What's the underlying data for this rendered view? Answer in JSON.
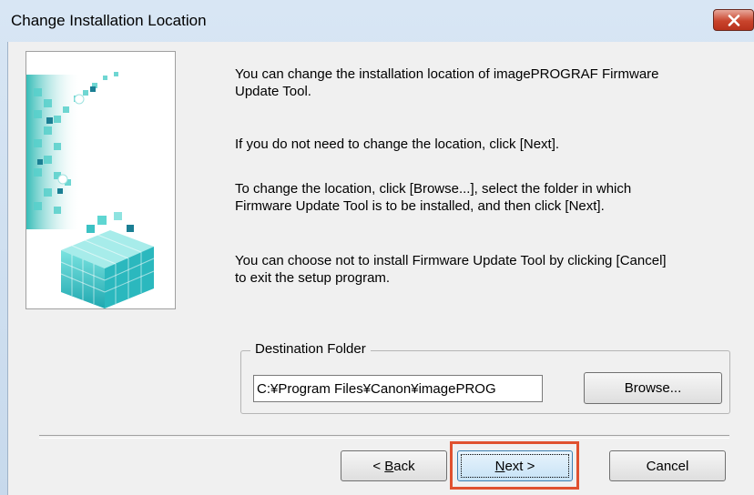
{
  "window": {
    "title": "Change Installation Location",
    "close_icon": "close-icon"
  },
  "messages": {
    "line1": "You can change the installation location of imagePROGRAF Firmware\nUpdate Tool.",
    "line2": "If you do not need to change the location, click [Next].",
    "line3": "To change the location, click [Browse...], select the folder in which\nFirmware Update Tool is to be installed, and then click [Next].",
    "line4": "You can choose not to install Firmware Update Tool by clicking [Cancel]\nto exit the setup program."
  },
  "destination": {
    "group_label": "Destination Folder",
    "path": "C:¥Program Files¥Canon¥imagePROG",
    "browse_label": "Browse..."
  },
  "buttons": {
    "back_label_prefix": "< ",
    "back_label_mnemonic": "B",
    "back_label_rest": "ack",
    "next_label_mnemonic": "N",
    "next_label_rest": "ext >",
    "cancel_label": "Cancel"
  },
  "colors": {
    "accent_teal": "#3bc6c6",
    "highlight": "#e0512f",
    "close_red": "#c9442c"
  }
}
